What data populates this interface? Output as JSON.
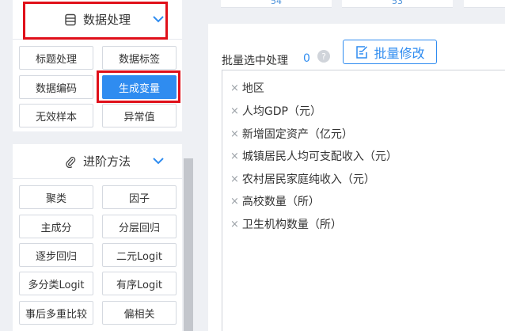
{
  "sidebar": {
    "data_processing": {
      "title": "数据处理",
      "buttons": [
        "标题处理",
        "数据标签",
        "数据编码",
        "生成变量",
        "无效样本",
        "异常值"
      ],
      "active": "生成变量"
    },
    "advanced_methods": {
      "title": "进阶方法",
      "buttons": [
        "聚类",
        "因子",
        "主成分",
        "分层回归",
        "逐步回归",
        "二元Logit",
        "多分类Logit",
        "有序Logit",
        "事后多重比较",
        "偏相关"
      ]
    }
  },
  "top_cards": [
    "54",
    "53"
  ],
  "main": {
    "batch_label": "批量选中处理",
    "batch_count": "0",
    "help_icon": "?",
    "batch_button": "批量修改",
    "variables": [
      "地区",
      "人均GDP（元）",
      "新增固定资产（亿元）",
      "城镇居民人均可支配收入（元）",
      "农村居民家庭纯收入（元）",
      "高校数量（所）",
      "卫生机构数量（所）"
    ],
    "remove_symbol": "×"
  },
  "colors": {
    "accent": "#2f8cf0",
    "highlight": "#e0101a",
    "background": "#eef0f4"
  },
  "icons": [
    "database-icon",
    "chevron-down-icon",
    "paperclip-icon",
    "edit-icon",
    "help-icon",
    "close-icon"
  ]
}
